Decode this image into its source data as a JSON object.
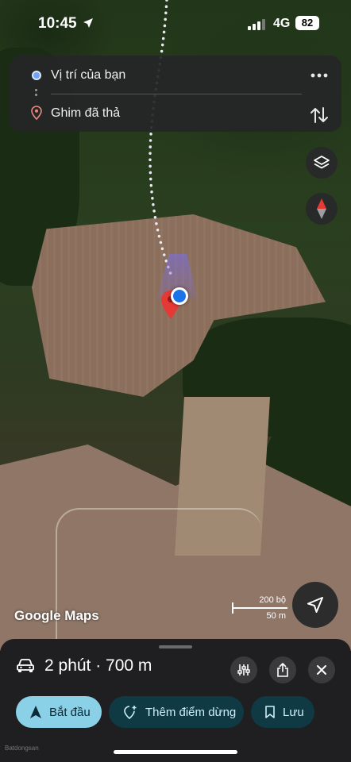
{
  "status_bar": {
    "time": "10:45",
    "network": "4G",
    "battery": "82"
  },
  "route": {
    "origin_label": "Vị trí của bạn",
    "destination_label": "Ghim đã thả"
  },
  "map": {
    "logo": "Google Maps",
    "scale_imperial": "200 bộ",
    "scale_metric": "50 m"
  },
  "trip": {
    "mode_icon": "car-icon",
    "summary": "2 phút · 700 m"
  },
  "actions": {
    "start_label": "Bắt đầu",
    "add_stop_label": "Thêm điểm dừng",
    "save_label": "Lưu"
  },
  "watermark": "Batdongsan",
  "colors": {
    "accent_start": "#8ad0e6",
    "pill_dark": "#0f3a44",
    "location_blue": "#1a73e8",
    "pin_red": "#e53935"
  }
}
